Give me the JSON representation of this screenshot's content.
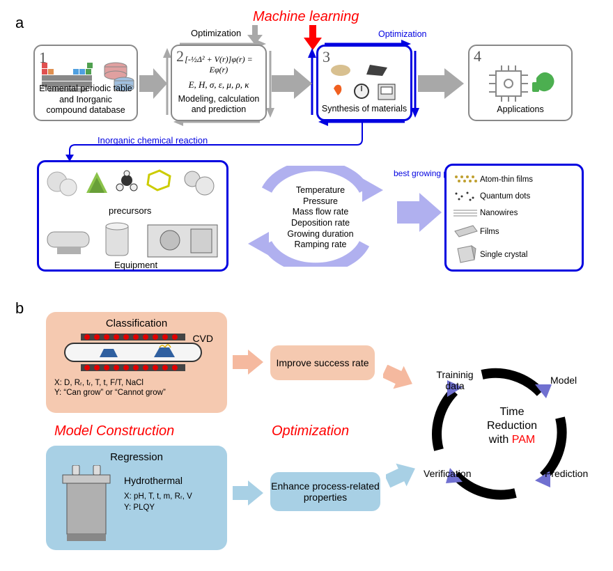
{
  "labels": {
    "panelA": "a",
    "panelB": "b"
  },
  "top": {
    "mlTitle": "Machine learning",
    "opt1": "Optimization",
    "opt2": "Optimization",
    "step1": {
      "num": "1",
      "caption": "Elemental periodic table and Inorganic compound database"
    },
    "step2": {
      "num": "2",
      "eq": "[-½Δ² + V(r)]φ(r) = Eφ(r)",
      "props": "E, H, σ, ε, μ, ρ, κ",
      "caption": "Modeling, calculation and prediction"
    },
    "step3": {
      "num": "3",
      "caption": "Synthesis of materials"
    },
    "step4": {
      "num": "4",
      "caption": "Applications"
    }
  },
  "mid": {
    "reactionLabel": "Inorganic chemical reaction",
    "precursors": "precursors",
    "equipment": "Equipment",
    "params": [
      "Temperature",
      "Pressure",
      "Mass flow rate",
      "Deposition rate",
      "Growing duration",
      "Ramping rate"
    ],
    "bestParams": "best growing parameters",
    "outputs": [
      "Atom-thin films",
      "Quantum dots",
      "Nanowires",
      "Films",
      "Single crystal"
    ]
  },
  "bottom": {
    "modelConstruction": "Model Construction",
    "optimization": "Optimization",
    "classification": {
      "title": "Classification",
      "method": "CVD",
      "x": "X: D, Rᵣ, tᵣ, T, t, F/T, NaCl",
      "y": "Y: “Can grow” or “Cannot grow”",
      "improve": "Improve success rate"
    },
    "regression": {
      "title": "Regression",
      "method": "Hydrothermal",
      "x": "X: pH, T, t, m, Rᵣ, V",
      "y": "Y: PLQY",
      "enhance": "Enhance process-related properties"
    },
    "cycle": {
      "training": "Traininig data",
      "model": "Model",
      "prediction": "Prediction",
      "verification": "Verification",
      "center1": "Time",
      "center2": "Reduction",
      "center3a": "with ",
      "center3b": "PAM"
    }
  }
}
